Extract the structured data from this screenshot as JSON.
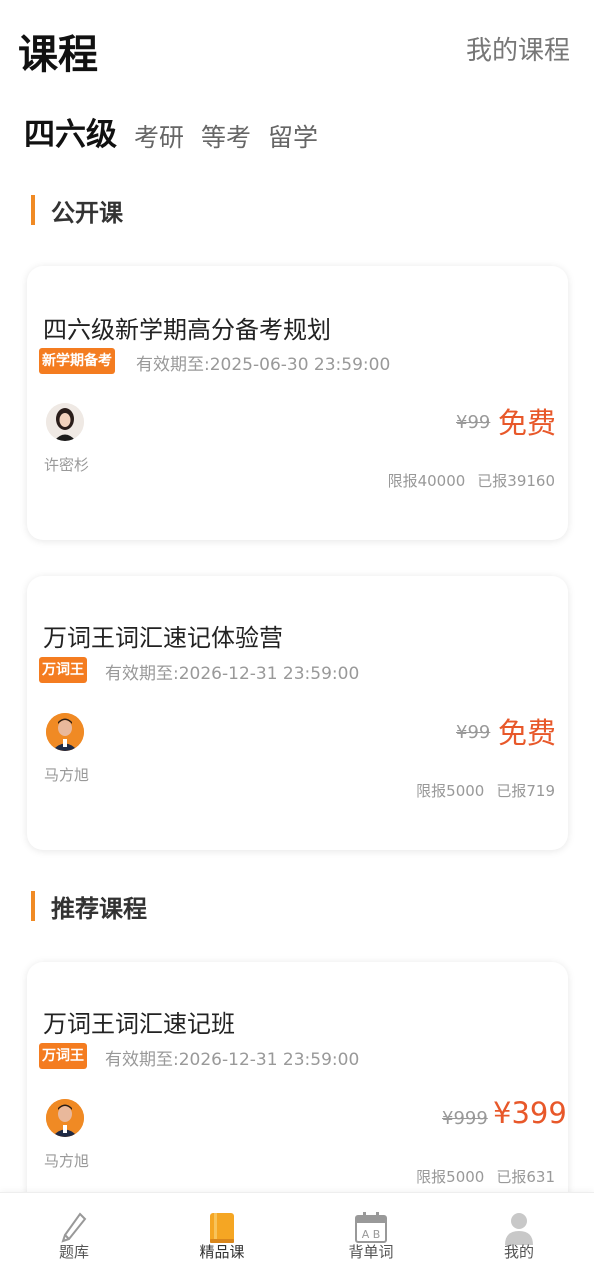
{
  "header": {
    "title": "课程",
    "my_courses": "我的课程"
  },
  "tabs": [
    "四六级",
    "考研",
    "等考",
    "留学"
  ],
  "sections": {
    "open": "公开课",
    "recommend": "推荐课程"
  },
  "cards": [
    {
      "title": "四六级新学期高分备考规划",
      "tag": "新学期备考",
      "valid": "有效期至:2025-06-30 23:59:00",
      "teacher": "许密杉",
      "price_old": "¥99",
      "price_new": "免费",
      "limit": "限报40000",
      "enrolled": "已报39160"
    },
    {
      "title": "万词王词汇速记体验营",
      "tag": "万词王",
      "valid": "有效期至:2026-12-31 23:59:00",
      "teacher": "马方旭",
      "price_old": "¥99",
      "price_new": "免费",
      "limit": "限报5000",
      "enrolled": "已报719"
    },
    {
      "title": "万词王词汇速记班",
      "tag": "万词王",
      "valid": "有效期至:2026-12-31 23:59:00",
      "teacher": "马方旭",
      "price_old": "¥999",
      "price_new": "¥399",
      "limit": "限报5000",
      "enrolled": "已报631"
    }
  ],
  "nav": [
    {
      "label": "题库",
      "icon": "pencil-icon"
    },
    {
      "label": "精品课",
      "icon": "book-icon",
      "active": true
    },
    {
      "label": "背单词",
      "icon": "calendar-ab-icon"
    },
    {
      "label": "我的",
      "icon": "person-icon"
    }
  ],
  "colors": {
    "accent": "#f08a24",
    "price": "#e8582a",
    "tag": "#f47c20",
    "nav_active": "#f5a623"
  }
}
